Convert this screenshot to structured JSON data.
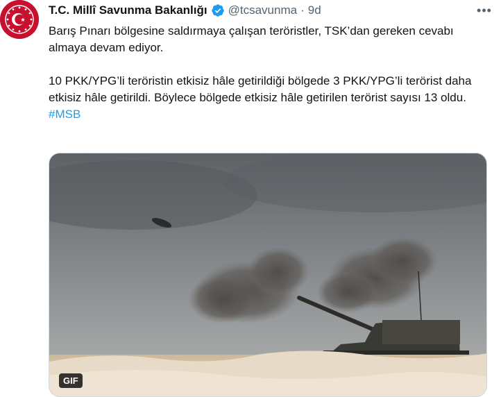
{
  "tweet": {
    "display_name": "T.C. Millî Savunma Bakanlığı",
    "handle": "@tcsavunma",
    "separator": "·",
    "time": "9d",
    "more_label": "•••",
    "paragraph1": "Barış Pınarı bölgesine saldırmaya çalışan teröristler, TSK’dan gereken cevabı almaya devam ediyor.",
    "paragraph2": "10 PKK/YPG’li teröristin etkisiz hâle getirildiği bölgede 3 PKK/YPG’li terörist daha etkisiz hâle getirildi. Böylece bölgede etkisiz hâle getirilen terörist sayısı 13 oldu.",
    "hashtag": "#MSB",
    "media_badge": "GIF"
  },
  "icons": {
    "avatar": "turkish-ministry-seal",
    "verified": "verified-badge-icon",
    "more": "more-horizontal-icon"
  },
  "colors": {
    "accent": "#1d9bf0",
    "text": "#0f1419",
    "secondary": "#536471",
    "avatar_red": "#c8102e"
  }
}
